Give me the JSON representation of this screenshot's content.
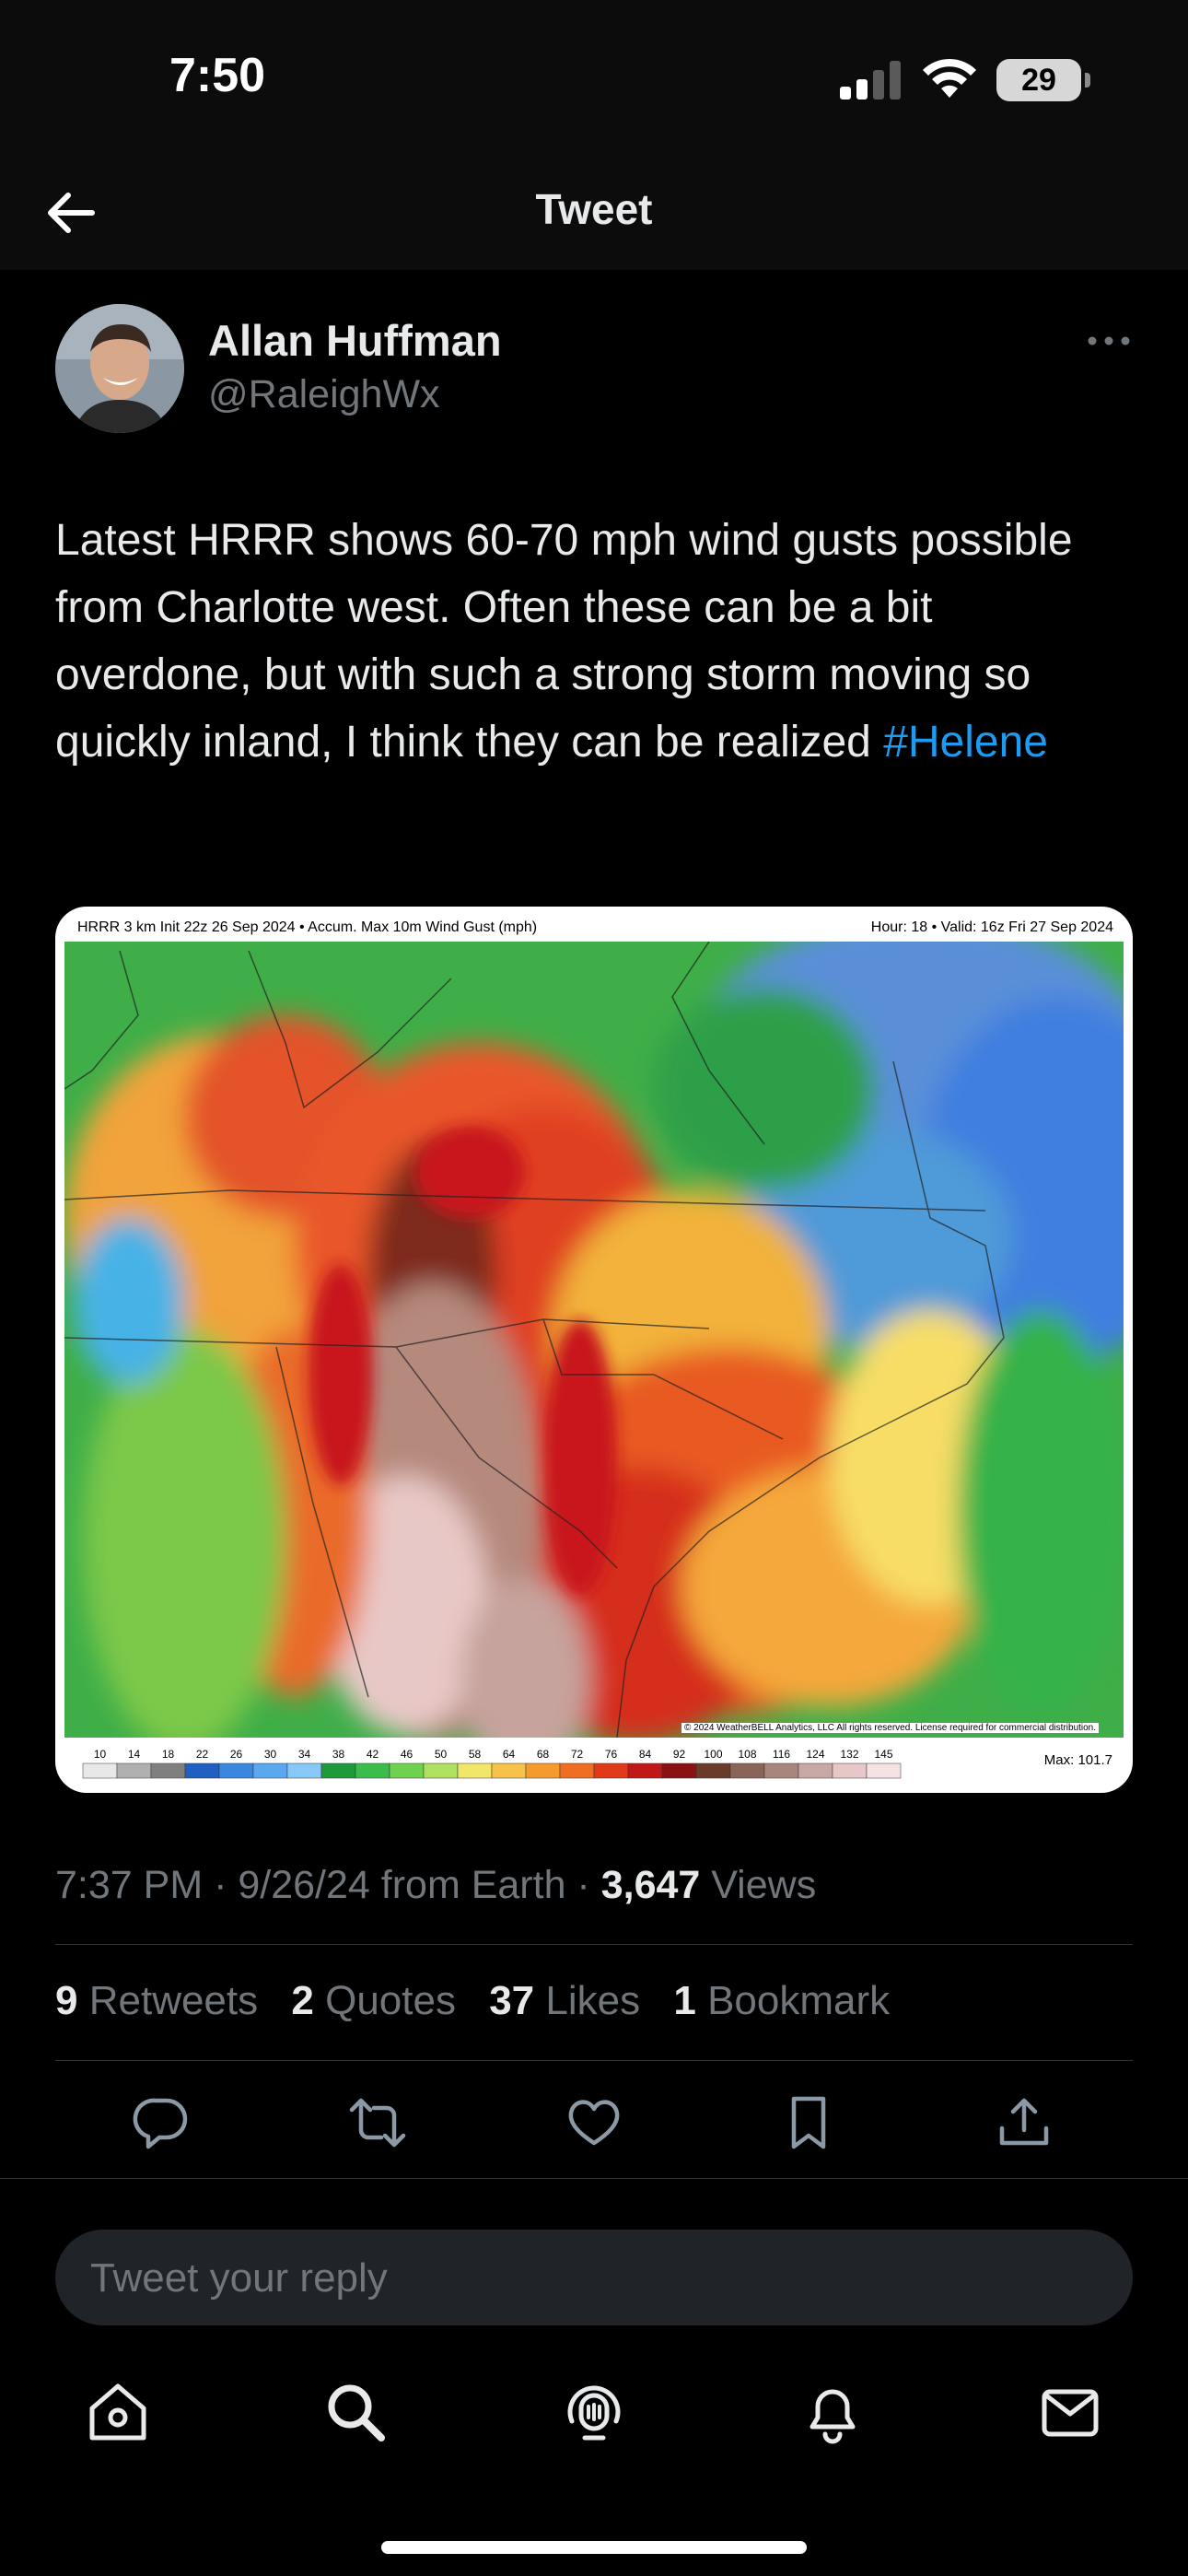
{
  "status_bar": {
    "time": "7:50",
    "battery": "29"
  },
  "nav": {
    "title": "Tweet"
  },
  "tweet": {
    "author_name": "Allan Huffman",
    "author_handle": "@RaleighWx",
    "text": "Latest HRRR shows 60-70 mph wind gusts possible from Charlotte west. Often these can be a bit overdone, but with such a strong storm moving so quickly inland, I think they can be realized",
    "hashtag": "#Helene",
    "timestamp": "7:37 PM · 9/26/24 from Earth ·",
    "views_count": "3,647",
    "views_label": "Views"
  },
  "media": {
    "header_left": "HRRR 3 km Init 22z 26 Sep 2024 • Accum. Max 10m Wind Gust (mph)",
    "header_right": "Hour: 18 • Valid: 16z Fri 27 Sep 2024",
    "copyright": "© 2024 WeatherBELL Analytics, LLC All rights reserved. License required for commercial distribution.",
    "max_label": "Max: 101.7",
    "legend_ticks": [
      "10",
      "14",
      "18",
      "22",
      "26",
      "30",
      "34",
      "38",
      "42",
      "46",
      "50",
      "58",
      "64",
      "68",
      "72",
      "76",
      "84",
      "92",
      "100",
      "108",
      "116",
      "124",
      "132",
      "145"
    ],
    "legend_colors": [
      "#e8e8e8",
      "#b0b0b0",
      "#7f7f7f",
      "#2060c0",
      "#3a86e0",
      "#5aa8f0",
      "#88c8f8",
      "#1f9a3a",
      "#3cbc4a",
      "#70d050",
      "#b0e060",
      "#f2e66a",
      "#f6c24a",
      "#f59a2c",
      "#ef6e22",
      "#e03a1a",
      "#c01818",
      "#8a1212",
      "#6a3a2a",
      "#8a6458",
      "#a8867e",
      "#c8a8a4",
      "#e6c8c8",
      "#f4e2e4"
    ]
  },
  "stats": {
    "retweets_count": "9",
    "retweets_label": "Retweets",
    "quotes_count": "2",
    "quotes_label": "Quotes",
    "likes_count": "37",
    "likes_label": "Likes",
    "bookmarks_count": "1",
    "bookmarks_label": "Bookmark"
  },
  "reply": {
    "placeholder": "Tweet your reply"
  },
  "icons": {
    "actions": [
      "reply-icon",
      "retweet-icon",
      "like-icon",
      "bookmark-icon",
      "share-icon"
    ],
    "tabs": [
      "home-icon",
      "search-icon",
      "spaces-icon",
      "notifications-icon",
      "messages-icon"
    ]
  }
}
